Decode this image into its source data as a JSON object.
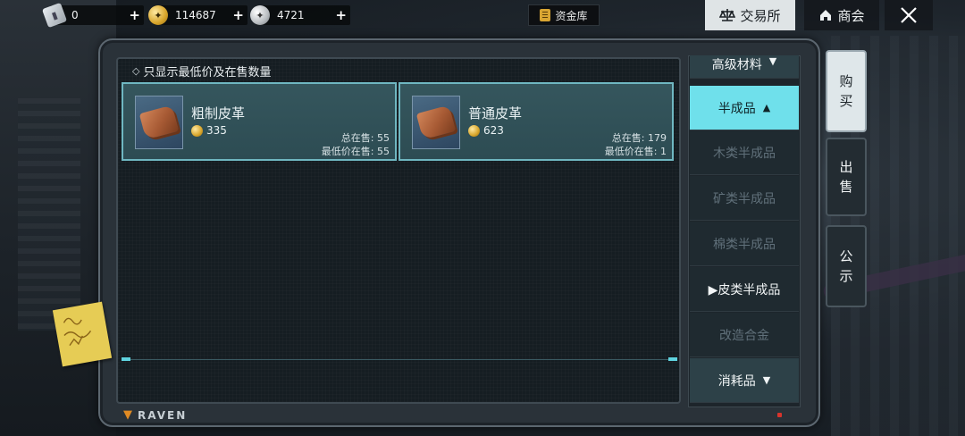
{
  "topbar": {
    "currencies": [
      {
        "icon": "voucher-icon",
        "amount": "0",
        "add": "+"
      },
      {
        "icon": "gold-coin-icon",
        "amount": "114687",
        "add": "+"
      },
      {
        "icon": "silver-coin-icon",
        "amount": "4721",
        "add": "+"
      }
    ],
    "vault_label": "资金库",
    "exchange_label": "交易所",
    "shop_label": "商会",
    "close_icon": "close-icon"
  },
  "filter": {
    "label": "只显示最低价及在售数量",
    "check_glyph": "◇"
  },
  "items": [
    {
      "name": "粗制皮革",
      "price": "335",
      "total_label": "总在售:",
      "total_value": "55",
      "lowest_label": "最低价在售:",
      "lowest_value": "55"
    },
    {
      "name": "普通皮革",
      "price": "623",
      "total_label": "总在售:",
      "total_value": "179",
      "lowest_label": "最低价在售:",
      "lowest_value": "1"
    }
  ],
  "categories": {
    "top_group": "高级材料",
    "active_group": "半成品",
    "subs": [
      "木类半成品",
      "矿类半成品",
      "棉类半成品",
      "▶皮类半成品",
      "改造合金"
    ],
    "bottom_group": "消耗品"
  },
  "side_tabs": [
    {
      "label_top": "购",
      "label_bottom": "买"
    },
    {
      "label_top": "出",
      "label_bottom": "售"
    },
    {
      "label_top": "公",
      "label_bottom": "示"
    }
  ],
  "brand": "RAVEN",
  "colors": {
    "accent": "#6fe0eb",
    "card_border": "#6fb7c1",
    "brand_mark": "#e08a23"
  }
}
